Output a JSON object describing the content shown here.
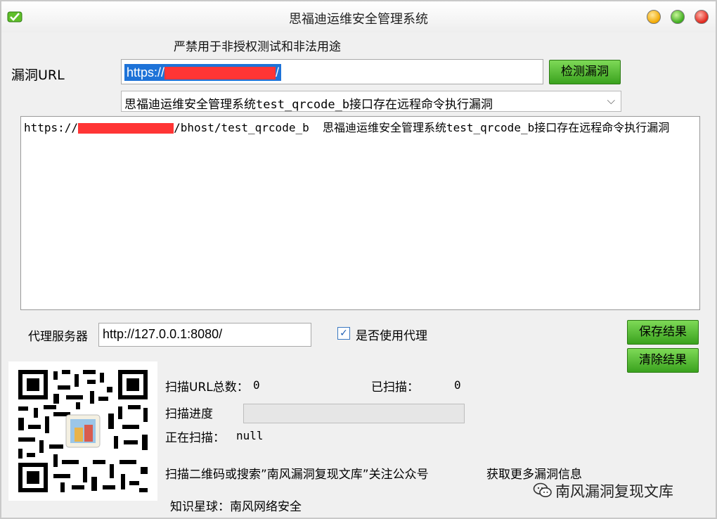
{
  "window": {
    "title": "思福迪运维安全管理系统"
  },
  "warning": "严禁用于非授权测试和非法用途",
  "url": {
    "label": "漏洞URL",
    "value_prefix": "https://",
    "value_suffix": "/",
    "check_button": "检测漏洞"
  },
  "vuln_select": {
    "selected": "思福迪运维安全管理系统test_qrcode_b接口存在远程命令执行漏洞"
  },
  "results": [
    {
      "prefix": "https://",
      "path": "/bhost/test_qrcode_b",
      "description": "思福迪运维安全管理系统test_qrcode_b接口存在远程命令执行漏洞"
    }
  ],
  "proxy": {
    "label": "代理服务器",
    "value": "http://127.0.0.1:8080/",
    "use_proxy_label": "是否使用代理",
    "use_proxy_checked": true
  },
  "actions": {
    "save": "保存结果",
    "clear": "清除结果"
  },
  "stats": {
    "total_label": "扫描URL总数：",
    "total_value": "0",
    "scanned_label": "已扫描：",
    "scanned_value": "0",
    "progress_label": "扫描进度",
    "progress_fraction": 0,
    "current_label": "正在扫描：",
    "current_value": "null"
  },
  "promo": {
    "scan_text": "扫描二维码或搜索”南风漏洞复现文库”关注公众号",
    "more_text": "获取更多漏洞信息",
    "planet_label": "知识星球：",
    "planet_value": "南风网络安全",
    "watermark": "南风漏洞复现文库"
  },
  "colors": {
    "button_green": "#4cb82a",
    "redaction": "#ff3535",
    "selection": "#1e73d8"
  },
  "icons": [
    "app-icon",
    "minimize-icon",
    "maximize-icon",
    "close-icon",
    "chevron-down-icon",
    "checkmark-icon",
    "qr-code",
    "wechat-icon"
  ]
}
